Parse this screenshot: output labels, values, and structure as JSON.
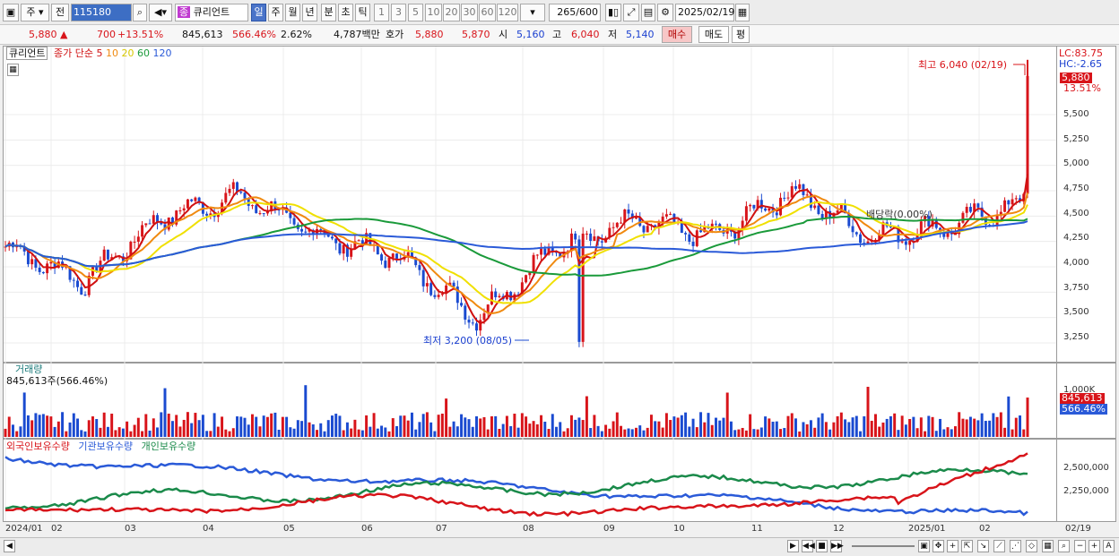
{
  "toolbar": {
    "market": "주",
    "prev": "전",
    "code": "115180",
    "stock_name": "큐리언트",
    "period_tabs": [
      "일",
      "주",
      "월",
      "년",
      "분",
      "초",
      "틱"
    ],
    "active_tab": "일",
    "intervals": [
      "1",
      "3",
      "5",
      "10",
      "20",
      "30",
      "60",
      "120"
    ],
    "count": "265",
    "count_max": "/600",
    "date": "2025/02/19"
  },
  "quote": {
    "price": "5,880",
    "change": "700",
    "change_pct": "+13.51%",
    "volume": "845,613",
    "volume_ratio": "566.46%",
    "turnover": "2.62%",
    "amount": "4,787백만",
    "ask_label": "호가",
    "ask": "5,880",
    "bid": "5,870",
    "open_label": "시",
    "open": "5,160",
    "high_label": "고",
    "high": "6,040",
    "low_label": "저",
    "low": "5,140",
    "buy_label": "매수",
    "sell_label": "매도",
    "avg_label": "평"
  },
  "price_panel": {
    "stock_tag": "큐리언트",
    "legend_prefix": "종가 단순",
    "ma_labels": [
      "5",
      "10",
      "20",
      "60",
      "120"
    ],
    "ma_colors": [
      "#d01010",
      "#f08a10",
      "#f0e000",
      "#1a9a3a",
      "#2a5ad8"
    ],
    "lc": "LC:83.75",
    "hc": "HC:-2.65",
    "price_tag": "5,880",
    "pct_tag": "13.51%",
    "high_note": "최고 6,040 (02/19)",
    "low_note": "최저 3,200 (08/05)",
    "dividend_note": "배당락(0.00%)",
    "y_ticks": [
      "5,500",
      "5,250",
      "5,000",
      "4,750",
      "4,500",
      "4,250",
      "4,000",
      "3,750",
      "3,500",
      "3,250"
    ]
  },
  "volume_panel": {
    "title": "거래량",
    "value": "845,613주(566.46%)",
    "y_tick": "1,000K",
    "tag_value": "845,613",
    "tag_pct": "566.46%"
  },
  "holdings_panel": {
    "legend": [
      "외국인보유수량",
      "기관보유수량",
      "개인보유수량"
    ],
    "y_ticks": [
      "2,500,000",
      "2,250,000"
    ]
  },
  "x_axis": [
    "2024/01",
    "02",
    "03",
    "04",
    "05",
    "06",
    "07",
    "08",
    "09",
    "10",
    "11",
    "12",
    "2025/01",
    "02",
    "02/19"
  ],
  "chart_data": [
    {
      "type": "candlestick",
      "title": "큐리언트",
      "x": [
        "2024/01",
        "02",
        "03",
        "04",
        "05",
        "06",
        "07",
        "08",
        "09",
        "10",
        "11",
        "12",
        "2025/01",
        "02"
      ],
      "close_approx": [
        4200,
        3850,
        4500,
        4700,
        4300,
        4100,
        3500,
        4200,
        4450,
        4300,
        4750,
        4300,
        4400,
        4650
      ],
      "high": 6040,
      "high_date": "02/19",
      "low": 3200,
      "low_date": "08/05",
      "last": 5880,
      "moving_averages": [
        "5",
        "10",
        "20",
        "60",
        "120"
      ],
      "ylim": [
        3100,
        6100
      ]
    },
    {
      "type": "bar",
      "title": "거래량",
      "last": 845613
    },
    {
      "type": "line",
      "series": [
        {
          "name": "외국인보유수량"
        },
        {
          "name": "기관보유수량"
        },
        {
          "name": "개인보유수량"
        }
      ]
    }
  ]
}
